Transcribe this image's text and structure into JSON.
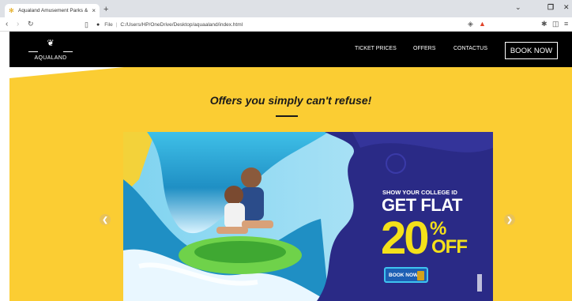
{
  "browser": {
    "tab_title": "Aqualand Amusement Parks & Re",
    "tab_close": "×",
    "new_tab": "+",
    "address_label": "File",
    "address_url": "C:/Users/HP/OneDrive/Desktop/aquaaland/index.html",
    "icons": [
      "back-icon",
      "forward-icon",
      "reload-icon",
      "bookmark-icon",
      "info-icon",
      "shield-icon",
      "alert-icon",
      "extensions-icon",
      "sidebar-icon",
      "menu-icon"
    ]
  },
  "site": {
    "logo_text": "AQUALAND",
    "nav": {
      "ticket_prices": "TICKET PRICES",
      "offers": "OFFERS",
      "contact": "CONTACTUS"
    },
    "book_now": "BOOK NOW",
    "heading": "Offers you simply can't refuse!",
    "banner": {
      "tagline": "SHOW YOUR COLLEGE ID",
      "flat": "GET FLAT",
      "number": "20",
      "percent": "%",
      "off": "OFF",
      "button": "BOOK NOW"
    },
    "colors": {
      "header_bg": "#000000",
      "section_bg": "#fbcd33",
      "banner_purple": "#2a2a86",
      "offer_yellow": "#f4e11a"
    }
  }
}
